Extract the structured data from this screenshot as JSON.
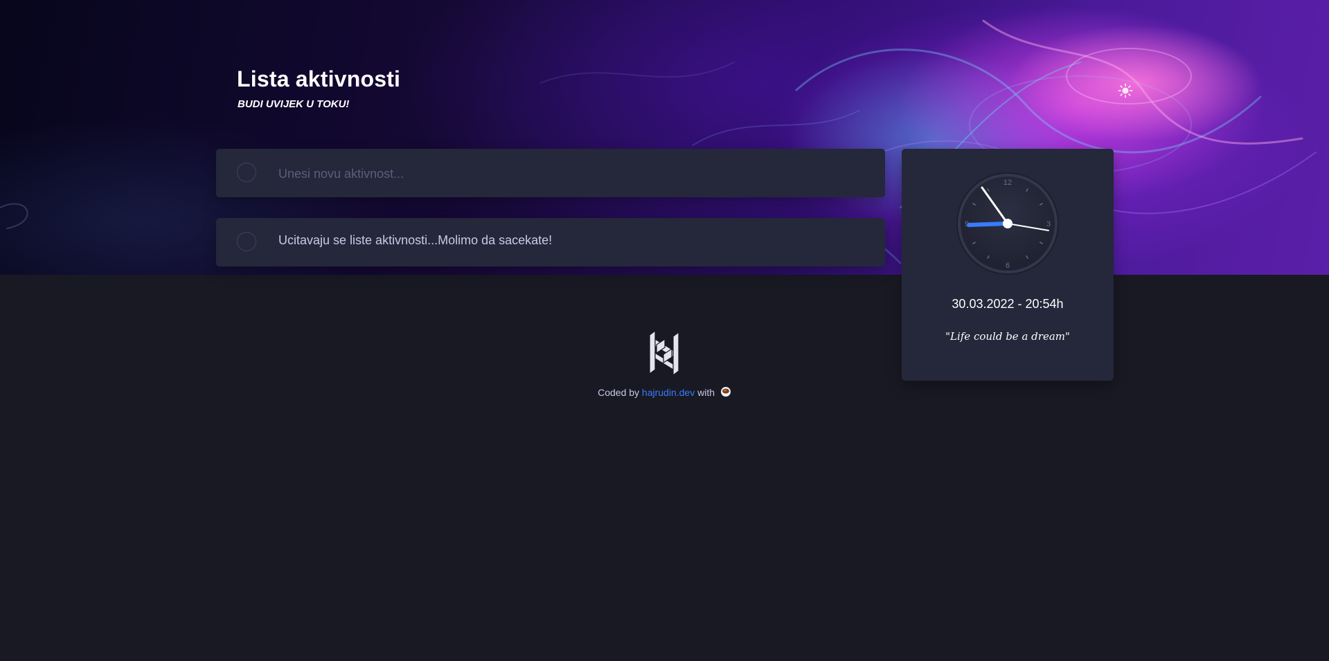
{
  "header": {
    "title": "Lista aktivnosti",
    "subtitle": "BUDI UVIJEK U TOKU!",
    "theme_toggle_icon": "sun-icon"
  },
  "new_todo": {
    "placeholder": "Unesi novu aktivnost...",
    "value": ""
  },
  "todo_list": {
    "loading_text": "Ucitavaju se liste aktivnosti...Molimo da sacekate!"
  },
  "clock": {
    "numbers": [
      "12",
      "3",
      "6",
      "9"
    ],
    "time": "20:54",
    "date_time_text": "30.03.2022 - 20:54h",
    "quote": "\"Life could be a dream\"",
    "accent_color": "#3a7bfd"
  },
  "footer": {
    "logo_icon": "hajrudin-logo-icon",
    "coded_by": "Coded by",
    "link_text": "hajrudin.dev",
    "with": "with",
    "coffee_icon": "coffee-icon"
  },
  "colors": {
    "background": "#181923",
    "card": "#25273a",
    "text": "#c8cbe7",
    "link": "#3a7bfd"
  }
}
